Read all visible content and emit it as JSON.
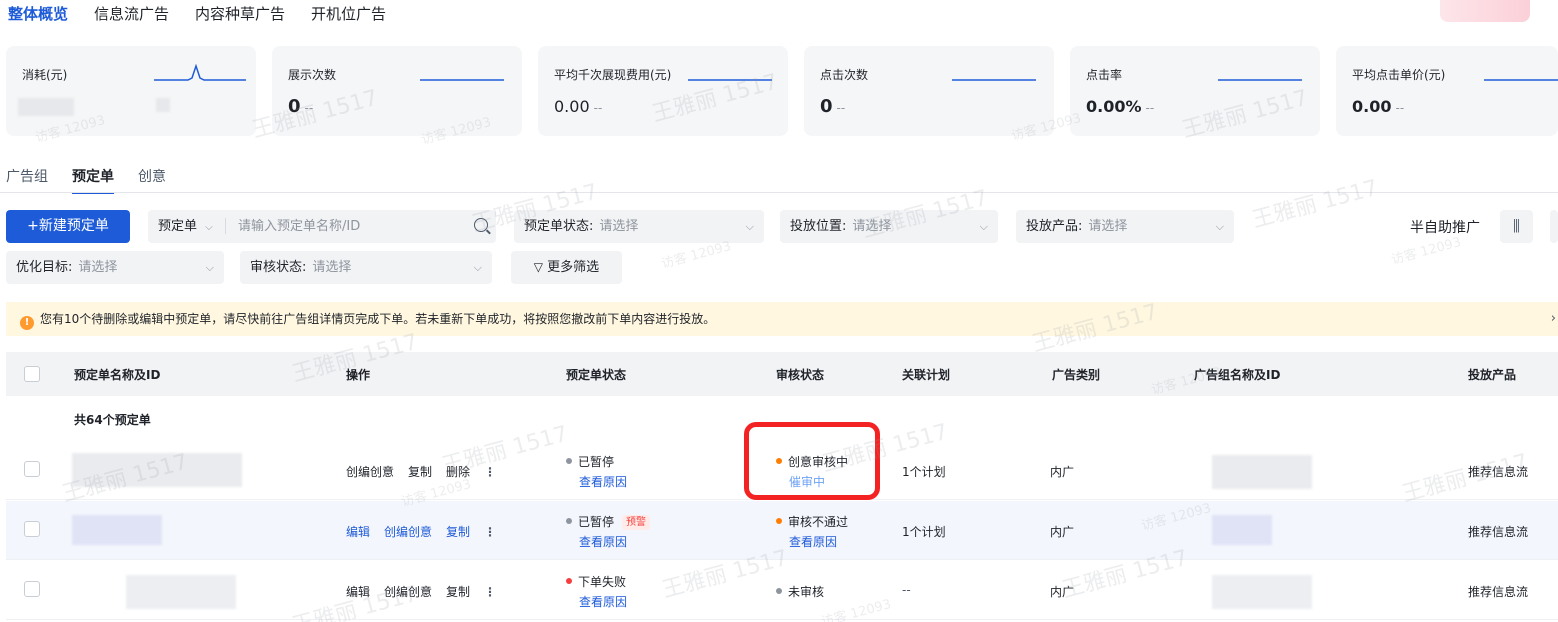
{
  "topnav": [
    {
      "label": "整体概览",
      "active": true
    },
    {
      "label": "信息流广告",
      "active": false
    },
    {
      "label": "内容种草广告",
      "active": false
    },
    {
      "label": "开机位广告",
      "active": false
    }
  ],
  "metrics": [
    {
      "label": "消耗(元)",
      "value": ""
    },
    {
      "label": "展示次数",
      "value": "0",
      "delta": "--"
    },
    {
      "label": "平均千次展现费用(元)",
      "value": "0.00",
      "delta": "--"
    },
    {
      "label": "点击次数",
      "value": "0",
      "delta": "--"
    },
    {
      "label": "点击率",
      "value": "0.00%",
      "delta": "--"
    },
    {
      "label": "平均点击单价(元)",
      "value": "0.00",
      "delta": "--"
    }
  ],
  "tabs": [
    {
      "label": "广告组",
      "active": false
    },
    {
      "label": "预定单",
      "active": true
    },
    {
      "label": "创意",
      "active": false
    }
  ],
  "filters": {
    "new_button": "+新建预定单",
    "search_type": "预定单",
    "search_placeholder": "请输入预定单名称/ID",
    "status": {
      "label": "预定单状态:",
      "placeholder": "请选择"
    },
    "position": {
      "label": "投放位置:",
      "placeholder": "请选择"
    },
    "product": {
      "label": "投放产品:",
      "placeholder": "请选择"
    },
    "goal": {
      "label": "优化目标:",
      "placeholder": "请选择"
    },
    "review": {
      "label": "审核状态:",
      "placeholder": "请选择"
    },
    "more": "更多筛选",
    "semi_auto": "半自助推广"
  },
  "notice": {
    "text": "您有10个待删除或编辑中预定单，请尽快前往广告组详情页完成下单。若未重新下单成功，将按照您撤改前下单内容进行投放。"
  },
  "table": {
    "headers": {
      "name": "预定单名称及ID",
      "ops": "操作",
      "status": "预定单状态",
      "review": "审核状态",
      "plan": "关联计划",
      "category": "广告类别",
      "group": "广告组名称及ID",
      "product": "投放产品"
    },
    "total": "共64个预定单",
    "rows": [
      {
        "ops": [
          "创编创意",
          "复制",
          "删除"
        ],
        "ops_link": false,
        "status": "已暂停",
        "status_color": "#8f959e",
        "status_link": "查看原因",
        "warn_tag": "",
        "review": "创意审核中",
        "review_color": "#ff7d00",
        "review_link": "催审中",
        "plan": "1个计划",
        "category": "内广",
        "product": "推荐信息流"
      },
      {
        "ops": [
          "编辑",
          "创编创意",
          "复制"
        ],
        "ops_link": true,
        "status": "已暂停",
        "status_color": "#8f959e",
        "status_link": "查看原因",
        "warn_tag": "预警",
        "review": "审核不通过",
        "review_color": "#ff7d00",
        "review_link": "查看原因",
        "plan": "1个计划",
        "category": "内广",
        "product": "推荐信息流"
      },
      {
        "ops": [
          "编辑",
          "创编创意",
          "复制"
        ],
        "ops_link": false,
        "status": "下单失败",
        "status_color": "#f53f3f",
        "status_link": "查看原因",
        "warn_tag": "",
        "review": "未审核",
        "review_color": "#8f959e",
        "review_link": "",
        "plan": "--",
        "category": "内广",
        "product": "推荐信息流"
      }
    ]
  },
  "watermark": {
    "name": "王雅丽 1517",
    "visitor": "访客 12093"
  }
}
